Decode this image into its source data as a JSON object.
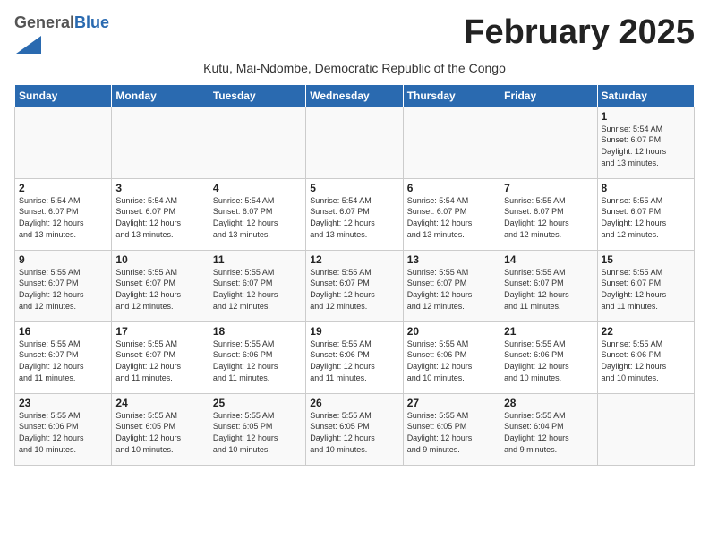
{
  "header": {
    "logo_general": "General",
    "logo_blue": "Blue",
    "month_title": "February 2025",
    "subtitle": "Kutu, Mai-Ndombe, Democratic Republic of the Congo"
  },
  "weekdays": [
    "Sunday",
    "Monday",
    "Tuesday",
    "Wednesday",
    "Thursday",
    "Friday",
    "Saturday"
  ],
  "weeks": [
    [
      {
        "day": "",
        "info": ""
      },
      {
        "day": "",
        "info": ""
      },
      {
        "day": "",
        "info": ""
      },
      {
        "day": "",
        "info": ""
      },
      {
        "day": "",
        "info": ""
      },
      {
        "day": "",
        "info": ""
      },
      {
        "day": "1",
        "info": "Sunrise: 5:54 AM\nSunset: 6:07 PM\nDaylight: 12 hours\nand 13 minutes."
      }
    ],
    [
      {
        "day": "2",
        "info": "Sunrise: 5:54 AM\nSunset: 6:07 PM\nDaylight: 12 hours\nand 13 minutes."
      },
      {
        "day": "3",
        "info": "Sunrise: 5:54 AM\nSunset: 6:07 PM\nDaylight: 12 hours\nand 13 minutes."
      },
      {
        "day": "4",
        "info": "Sunrise: 5:54 AM\nSunset: 6:07 PM\nDaylight: 12 hours\nand 13 minutes."
      },
      {
        "day": "5",
        "info": "Sunrise: 5:54 AM\nSunset: 6:07 PM\nDaylight: 12 hours\nand 13 minutes."
      },
      {
        "day": "6",
        "info": "Sunrise: 5:54 AM\nSunset: 6:07 PM\nDaylight: 12 hours\nand 13 minutes."
      },
      {
        "day": "7",
        "info": "Sunrise: 5:55 AM\nSunset: 6:07 PM\nDaylight: 12 hours\nand 12 minutes."
      },
      {
        "day": "8",
        "info": "Sunrise: 5:55 AM\nSunset: 6:07 PM\nDaylight: 12 hours\nand 12 minutes."
      }
    ],
    [
      {
        "day": "9",
        "info": "Sunrise: 5:55 AM\nSunset: 6:07 PM\nDaylight: 12 hours\nand 12 minutes."
      },
      {
        "day": "10",
        "info": "Sunrise: 5:55 AM\nSunset: 6:07 PM\nDaylight: 12 hours\nand 12 minutes."
      },
      {
        "day": "11",
        "info": "Sunrise: 5:55 AM\nSunset: 6:07 PM\nDaylight: 12 hours\nand 12 minutes."
      },
      {
        "day": "12",
        "info": "Sunrise: 5:55 AM\nSunset: 6:07 PM\nDaylight: 12 hours\nand 12 minutes."
      },
      {
        "day": "13",
        "info": "Sunrise: 5:55 AM\nSunset: 6:07 PM\nDaylight: 12 hours\nand 12 minutes."
      },
      {
        "day": "14",
        "info": "Sunrise: 5:55 AM\nSunset: 6:07 PM\nDaylight: 12 hours\nand 11 minutes."
      },
      {
        "day": "15",
        "info": "Sunrise: 5:55 AM\nSunset: 6:07 PM\nDaylight: 12 hours\nand 11 minutes."
      }
    ],
    [
      {
        "day": "16",
        "info": "Sunrise: 5:55 AM\nSunset: 6:07 PM\nDaylight: 12 hours\nand 11 minutes."
      },
      {
        "day": "17",
        "info": "Sunrise: 5:55 AM\nSunset: 6:07 PM\nDaylight: 12 hours\nand 11 minutes."
      },
      {
        "day": "18",
        "info": "Sunrise: 5:55 AM\nSunset: 6:06 PM\nDaylight: 12 hours\nand 11 minutes."
      },
      {
        "day": "19",
        "info": "Sunrise: 5:55 AM\nSunset: 6:06 PM\nDaylight: 12 hours\nand 11 minutes."
      },
      {
        "day": "20",
        "info": "Sunrise: 5:55 AM\nSunset: 6:06 PM\nDaylight: 12 hours\nand 10 minutes."
      },
      {
        "day": "21",
        "info": "Sunrise: 5:55 AM\nSunset: 6:06 PM\nDaylight: 12 hours\nand 10 minutes."
      },
      {
        "day": "22",
        "info": "Sunrise: 5:55 AM\nSunset: 6:06 PM\nDaylight: 12 hours\nand 10 minutes."
      }
    ],
    [
      {
        "day": "23",
        "info": "Sunrise: 5:55 AM\nSunset: 6:06 PM\nDaylight: 12 hours\nand 10 minutes."
      },
      {
        "day": "24",
        "info": "Sunrise: 5:55 AM\nSunset: 6:05 PM\nDaylight: 12 hours\nand 10 minutes."
      },
      {
        "day": "25",
        "info": "Sunrise: 5:55 AM\nSunset: 6:05 PM\nDaylight: 12 hours\nand 10 minutes."
      },
      {
        "day": "26",
        "info": "Sunrise: 5:55 AM\nSunset: 6:05 PM\nDaylight: 12 hours\nand 10 minutes."
      },
      {
        "day": "27",
        "info": "Sunrise: 5:55 AM\nSunset: 6:05 PM\nDaylight: 12 hours\nand 9 minutes."
      },
      {
        "day": "28",
        "info": "Sunrise: 5:55 AM\nSunset: 6:04 PM\nDaylight: 12 hours\nand 9 minutes."
      },
      {
        "day": "",
        "info": ""
      }
    ]
  ]
}
